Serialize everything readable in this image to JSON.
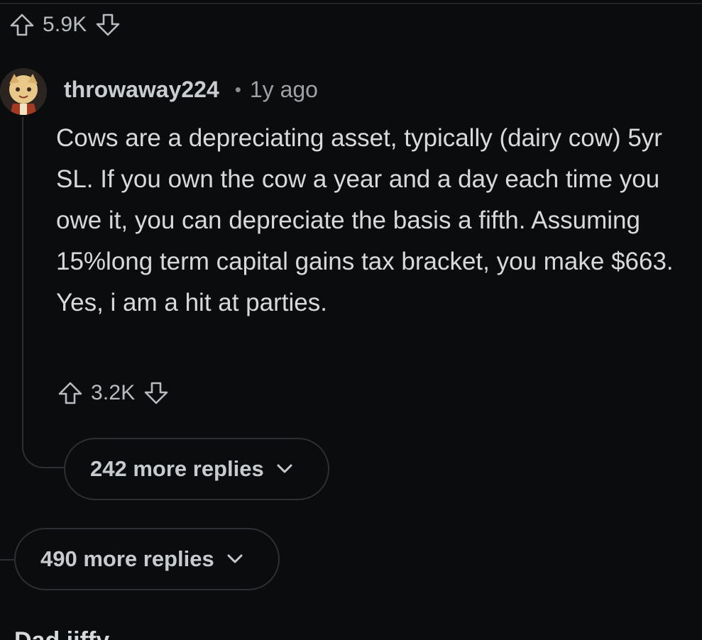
{
  "post": {
    "vote_count": "5.9K"
  },
  "comment": {
    "username": "throwaway224",
    "separator": "•",
    "time_ago": "1y ago",
    "body": "Cows are a depreciating asset, typically (dairy cow) 5yr SL. If you own the cow a year and a day each time you owe it, you can depreciate the basis a fifth. Assuming 15%long term capital gains tax bracket, you make $663. Yes, i am a hit at parties.",
    "vote_count": "3.2K",
    "more_replies_label": "242 more replies"
  },
  "thread": {
    "more_replies_label": "490 more replies",
    "next_comment_partial": "Dad jiffy..."
  },
  "icons": {
    "upvote": "arrow-up-outline-icon",
    "downvote": "arrow-down-outline-icon",
    "expand": "chevron-down-icon"
  },
  "colors": {
    "background": "#0b0c0e",
    "text": "#d7dadc",
    "muted": "#9ea2a6",
    "border": "#2c2f33"
  }
}
